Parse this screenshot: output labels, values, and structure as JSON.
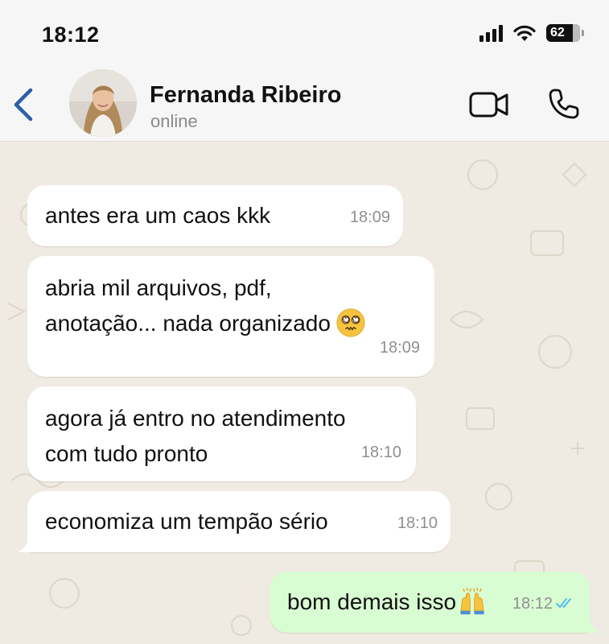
{
  "status_bar": {
    "time": "18:12",
    "battery": "62"
  },
  "header": {
    "contact_name": "Fernanda Ribeiro",
    "contact_status": "online",
    "icons": [
      "chevron-left-icon",
      "avatar",
      "video-camera-icon",
      "phone-icon"
    ]
  },
  "messages": [
    {
      "direction": "incoming",
      "text": "antes era um caos kkk",
      "time": "18:09"
    },
    {
      "direction": "incoming",
      "text": "abria mil arquivos, pdf,\nanotação... nada organizado",
      "emoji": "dizzy-face-emoji",
      "time": "18:09"
    },
    {
      "direction": "incoming",
      "text": "agora já entro no atendimento\ncom tudo pronto",
      "time": "18:10"
    },
    {
      "direction": "incoming",
      "text": "economiza um tempão sério",
      "time": "18:10"
    },
    {
      "direction": "outgoing",
      "text": "bom demais isso",
      "emoji": "raising-hands-emoji",
      "time": "18:12",
      "read_receipt": "double-check-icon"
    }
  ],
  "colors": {
    "accent": "#2c5fa8",
    "chat_background": "#efeae2",
    "incoming_bubble": "#ffffff",
    "outgoing_bubble": "#d9fdd3",
    "read_check": "#53bdeb"
  }
}
